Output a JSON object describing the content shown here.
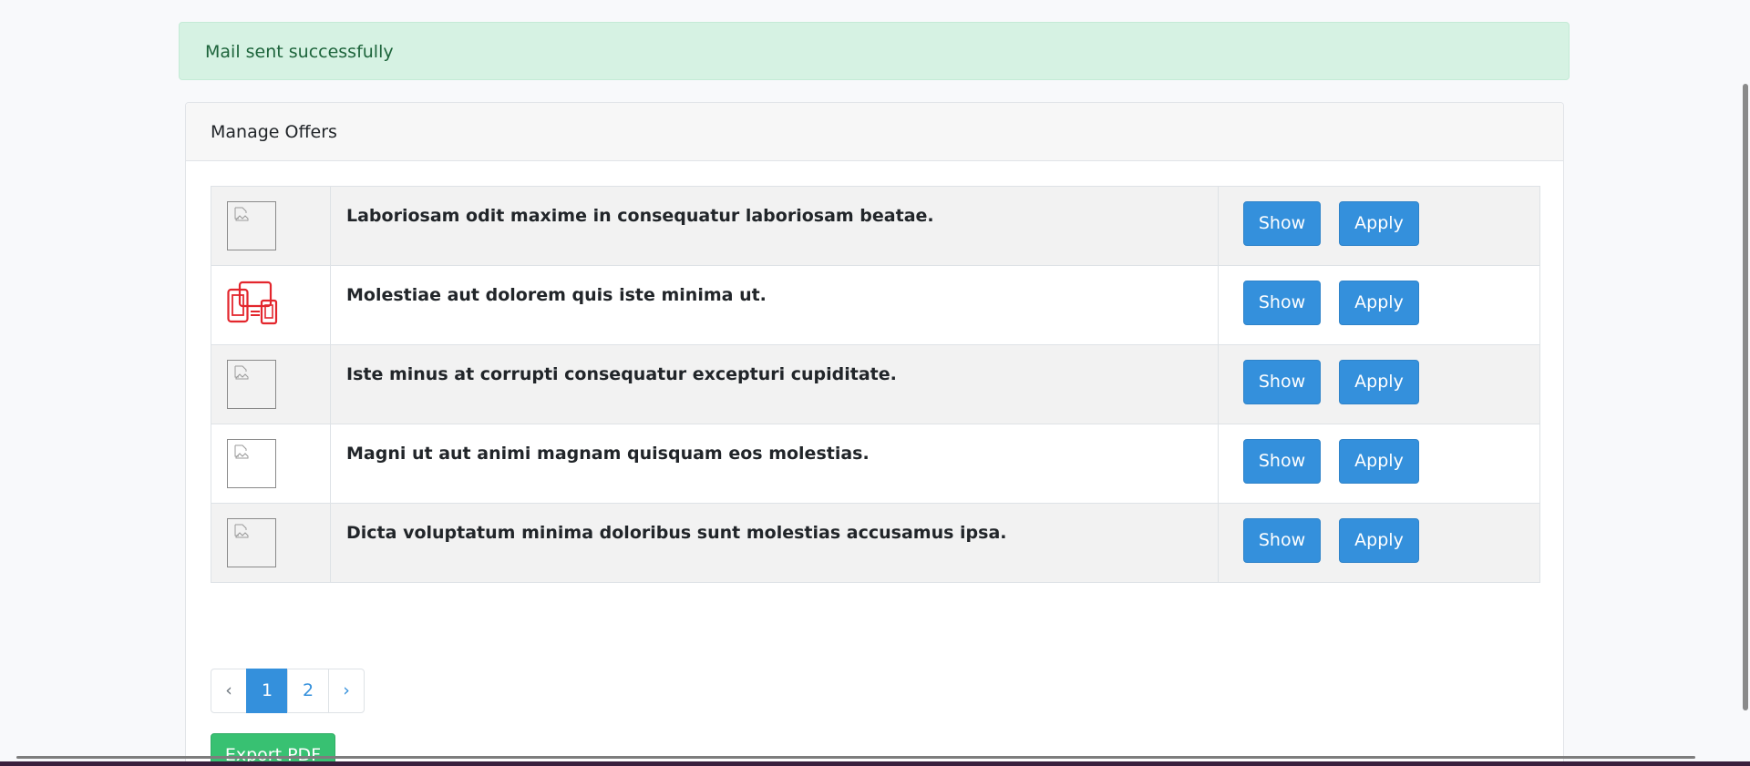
{
  "alert": {
    "message": "Mail sent successfully"
  },
  "card": {
    "title": "Manage Offers"
  },
  "offers": [
    {
      "title": "Laboriosam odit maxime in consequatur laboriosam beatae.",
      "image": "broken-image-icon",
      "show_label": "Show",
      "apply_label": "Apply"
    },
    {
      "title": "Molestiae aut dolorem quis iste minima ut.",
      "image": "devices-icon",
      "show_label": "Show",
      "apply_label": "Apply"
    },
    {
      "title": "Iste minus at corrupti consequatur excepturi cupiditate.",
      "image": "broken-image-icon",
      "show_label": "Show",
      "apply_label": "Apply"
    },
    {
      "title": "Magni ut aut animi magnam quisquam eos molestias.",
      "image": "broken-image-icon",
      "show_label": "Show",
      "apply_label": "Apply"
    },
    {
      "title": "Dicta voluptatum minima doloribus sunt molestias accusamus ipsa.",
      "image": "broken-image-icon",
      "show_label": "Show",
      "apply_label": "Apply"
    }
  ],
  "pagination": {
    "prev": "‹",
    "pages": [
      "1",
      "2"
    ],
    "active_page": "1",
    "next": "›"
  },
  "export": {
    "label": "Export PDF"
  },
  "colors": {
    "primary": "#3490dc",
    "success": "#38c172",
    "alert_bg": "#d6f2e3",
    "alert_text": "#1d643b",
    "device_icon": "#e3262d"
  }
}
